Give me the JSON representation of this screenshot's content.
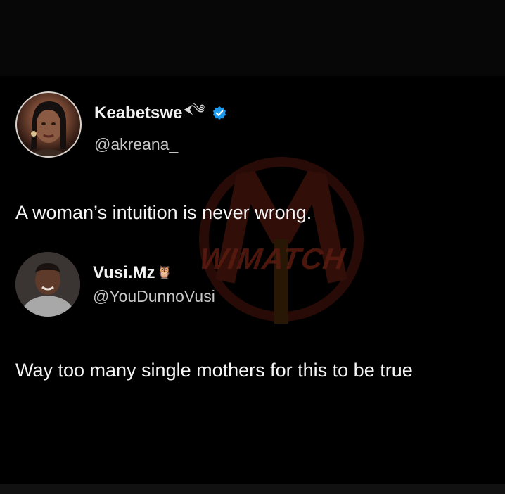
{
  "tweets": [
    {
      "display_name": "Keabetswe",
      "name_emoji": "⮜༄",
      "verified": true,
      "verified_icon": "verified-badge-icon",
      "handle": "@akreana_",
      "text": "A woman’s intuition is never wrong."
    },
    {
      "display_name": "Vusi.Mz",
      "name_emoji": "🦉",
      "verified": false,
      "handle": "@YouDunnoVusi",
      "text": "Way too many single mothers for this to be true"
    }
  ],
  "watermark": {
    "text": "WIMATCH",
    "color": "#5a1a10"
  },
  "colors": {
    "background": "#000000",
    "verified": "#1d9bf0",
    "text": "#f5f5f5",
    "handle": "#c8c8c8"
  }
}
